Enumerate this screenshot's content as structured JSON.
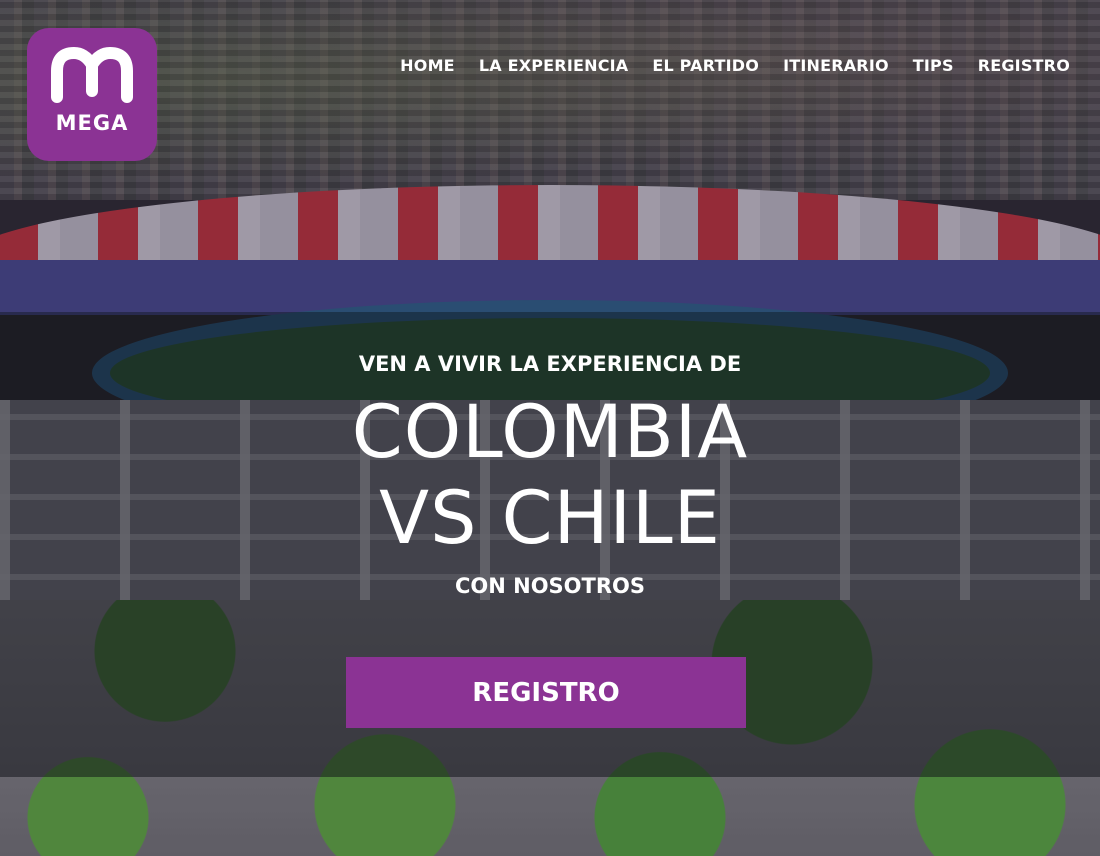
{
  "brand": {
    "name": "MEGA",
    "color": "#8b3394"
  },
  "nav": {
    "items": [
      {
        "label": "HOME"
      },
      {
        "label": "LA EXPERIENCIA"
      },
      {
        "label": "EL PARTIDO"
      },
      {
        "label": "ITINERARIO"
      },
      {
        "label": "TIPS"
      },
      {
        "label": "REGISTRO"
      }
    ]
  },
  "hero": {
    "pre_title": "VEN A VIVIR LA EXPERIENCIA DE",
    "title_line1": "COLOMBIA",
    "title_line2": "VS CHILE",
    "subtitle": "CON NOSOTROS",
    "cta_label": "REGISTRO"
  }
}
